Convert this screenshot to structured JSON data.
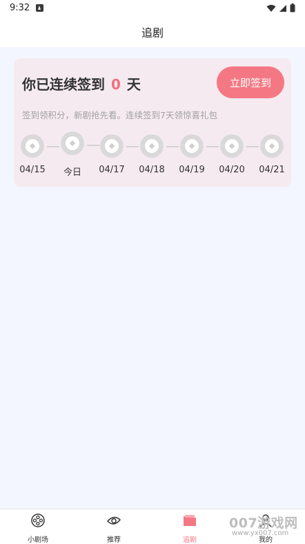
{
  "status_bar": {
    "time": "9:32"
  },
  "header": {
    "title": "追剧"
  },
  "checkin": {
    "title_prefix": "你已连续签到",
    "days": "0",
    "title_suffix": "天",
    "button_label": "立即签到",
    "subtitle": "签到领积分，新剧抢先看。连续签到7天领惊喜礼包",
    "days_list": [
      {
        "label": "04/15"
      },
      {
        "label": "今日"
      },
      {
        "label": "04/17"
      },
      {
        "label": "04/18"
      },
      {
        "label": "04/19"
      },
      {
        "label": "04/20"
      },
      {
        "label": "04/21"
      }
    ],
    "accent_color": "#f47883",
    "coin_icon": "coin-icon"
  },
  "tabbar": {
    "tabs": [
      {
        "label": "小剧场",
        "icon": "film-reel-icon"
      },
      {
        "label": "推荐",
        "icon": "eye-icon"
      },
      {
        "label": "追剧",
        "icon": "folder-icon",
        "active": true
      },
      {
        "label": "我的",
        "icon": "user-icon"
      }
    ]
  },
  "watermark": {
    "text": "007游戏网",
    "url": "www.yx007.com"
  }
}
